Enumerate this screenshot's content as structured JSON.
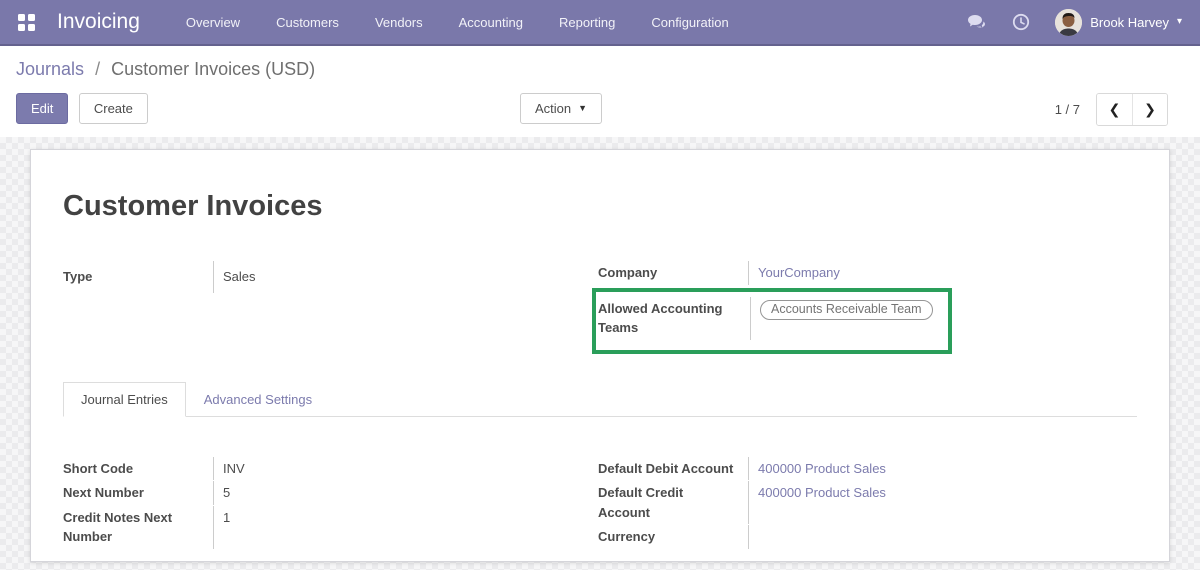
{
  "nav": {
    "app_name": "Invoicing",
    "menu_items": [
      "Overview",
      "Customers",
      "Vendors",
      "Accounting",
      "Reporting",
      "Configuration"
    ],
    "user_name": "Brook Harvey"
  },
  "breadcrumb": {
    "parent": "Journals",
    "separator": "/",
    "current": "Customer Invoices (USD)"
  },
  "buttons": {
    "edit": "Edit",
    "create": "Create",
    "action": "Action"
  },
  "pager": {
    "value": "1 / 7",
    "prev": "❮",
    "next": "❯"
  },
  "sheet": {
    "title": "Customer Invoices",
    "fields": {
      "type": {
        "label": "Type",
        "value": "Sales"
      },
      "company": {
        "label": "Company",
        "value": "YourCompany"
      },
      "allowed_teams": {
        "label": "Allowed Accounting Teams",
        "tag": "Accounts Receivable Team"
      },
      "short_code": {
        "label": "Short Code",
        "value": "INV"
      },
      "next_number": {
        "label": "Next Number",
        "value": "5"
      },
      "credit_notes_next_number": {
        "label": "Credit Notes Next Number",
        "value": "1"
      },
      "default_debit_account": {
        "label": "Default Debit Account",
        "value": "400000 Product Sales"
      },
      "default_credit_account": {
        "label": "Default Credit Account",
        "value": "400000 Product Sales"
      },
      "currency": {
        "label": "Currency",
        "value": ""
      }
    },
    "tabs": [
      {
        "label": "Journal Entries",
        "active": true
      },
      {
        "label": "Advanced Settings",
        "active": false
      }
    ]
  },
  "icons": {
    "apps": "apps-grid-icon",
    "messages": "chat-bubbles-icon",
    "activities": "clock-icon",
    "user_caret": "caret-down-icon",
    "action_caret": "caret-down-icon",
    "pager_prev": "chevron-left-icon",
    "pager_next": "chevron-right-icon"
  },
  "colors": {
    "navbar_bg": "#7a78aa",
    "link": "#7c7bad",
    "primary_button": "#7c7bad",
    "highlight_green": "#2a9e5a",
    "border": "#dddddd"
  }
}
